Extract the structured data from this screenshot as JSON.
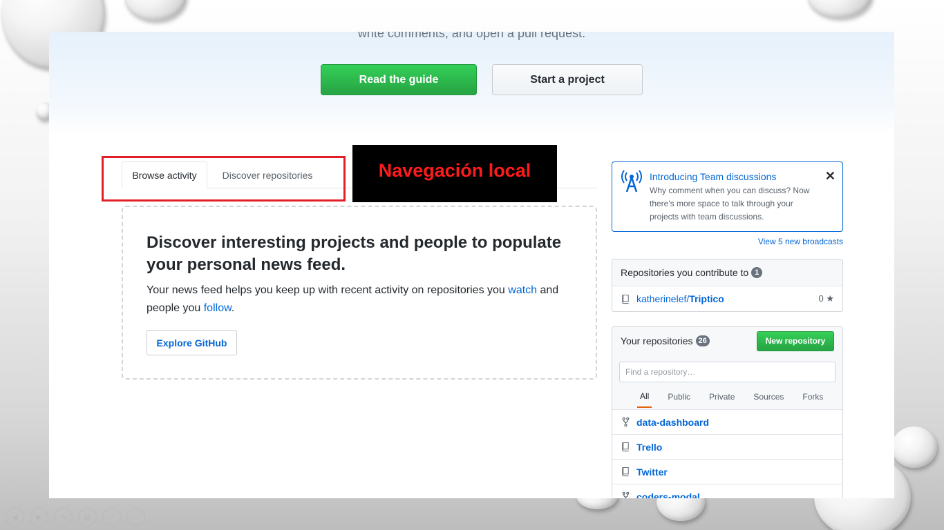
{
  "hero": {
    "subtitle": "write comments, and open a pull request.",
    "read_guide": "Read the guide",
    "start_project": "Start a project"
  },
  "tabs": [
    {
      "label": "Browse activity",
      "active": true
    },
    {
      "label": "Discover repositories",
      "active": false
    }
  ],
  "callout": {
    "text": "Navegación local",
    "color": "#ff1b1b"
  },
  "blankslate": {
    "title": "Discover interesting projects and people to populate your personal news feed.",
    "text_before": "Your news feed helps you keep up with recent activity on repositories you ",
    "watch_link": "watch",
    "text_middle": " and people you ",
    "follow_link": "follow",
    "text_end": ".",
    "explore_button": "Explore GitHub"
  },
  "broadcast": {
    "title": "Introducing Team discussions",
    "text": "Why comment when you can discuss? Now there's more space to talk through your projects with team discussions.",
    "close": "✕",
    "view_link": "View 5 new broadcasts"
  },
  "contribute": {
    "title": "Repositories you contribute to",
    "count": "1",
    "repo_owner": "katherinelef/",
    "repo_name": "Triptico",
    "stars": "0"
  },
  "your_repos": {
    "title": "Your repositories",
    "count": "26",
    "new_button": "New repository",
    "search_placeholder": "Find a repository…",
    "filters": [
      "All",
      "Public",
      "Private",
      "Sources",
      "Forks"
    ],
    "repos": [
      {
        "name": "data-dashboard",
        "icon": "fork-icon"
      },
      {
        "name": "Trello",
        "icon": "repo-icon"
      },
      {
        "name": "Twitter",
        "icon": "repo-icon"
      },
      {
        "name": "coders-modal",
        "icon": "fork-icon"
      }
    ]
  },
  "colors": {
    "accent_green": "#28a745",
    "link_blue": "#0366d6",
    "highlight_red": "#e21f26"
  }
}
